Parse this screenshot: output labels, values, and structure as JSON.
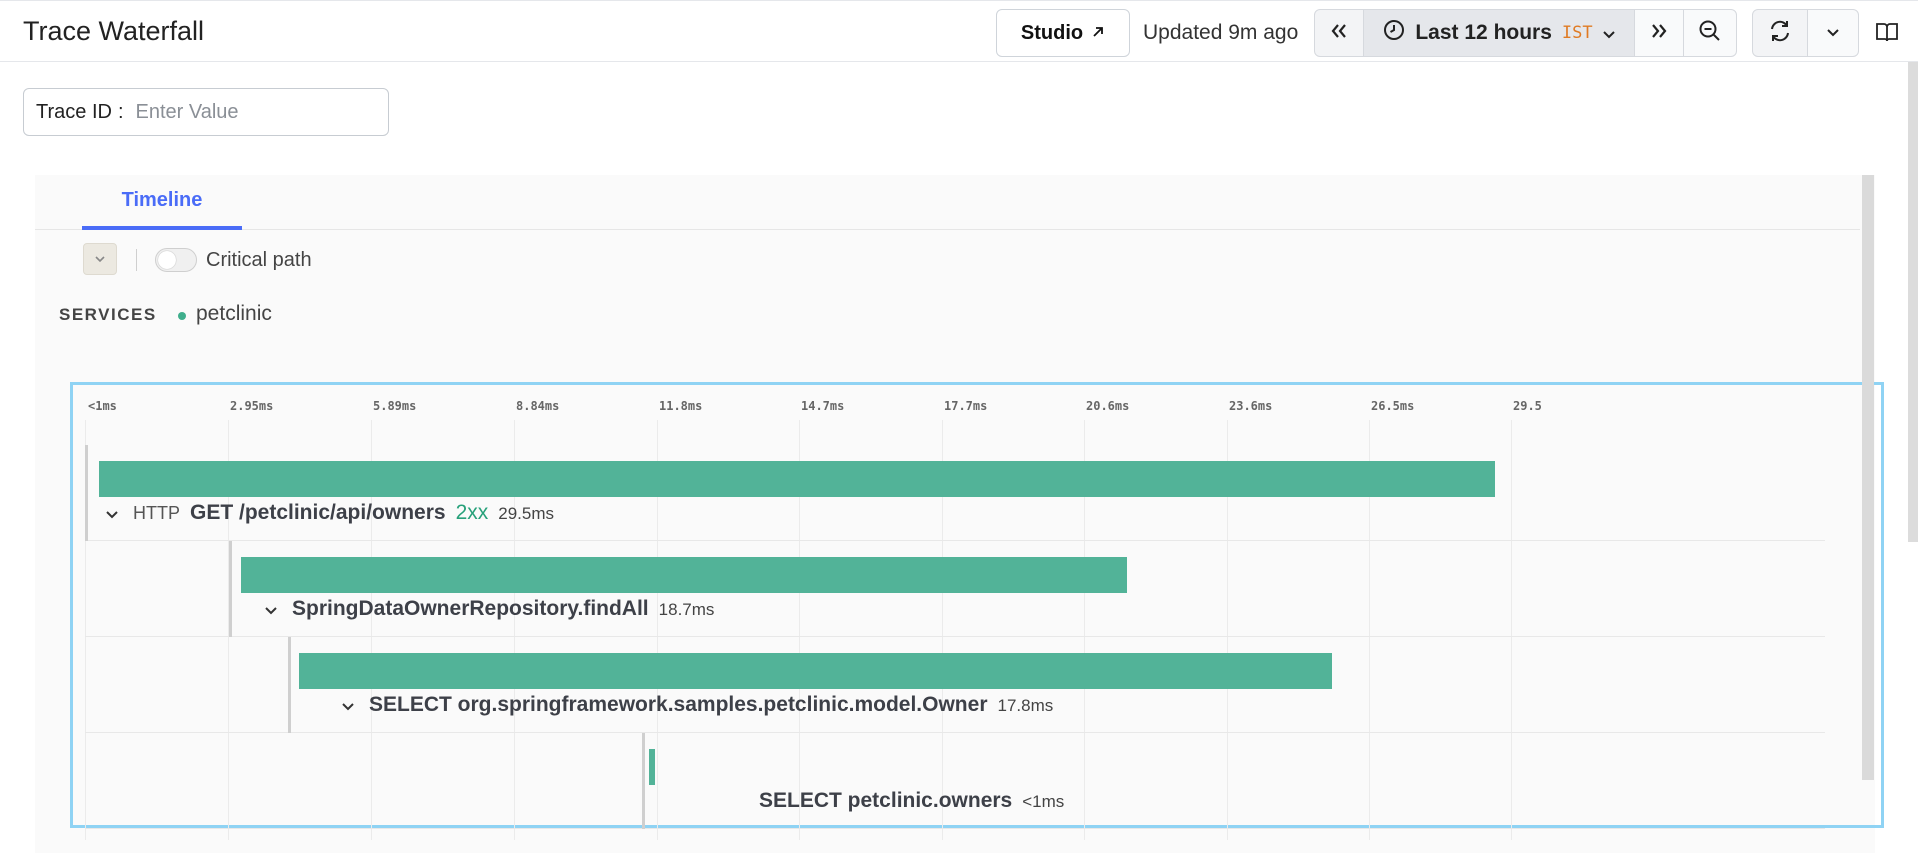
{
  "header": {
    "title": "Trace Waterfall",
    "studio_label": "Studio",
    "updated_text": "Updated 9m ago",
    "time_range": "Last 12 hours",
    "timezone": "IST"
  },
  "trace": {
    "label": "Trace ID",
    "separator": ":",
    "placeholder": "Enter Value"
  },
  "tabs": [
    {
      "label": "Timeline"
    }
  ],
  "toolbar": {
    "critical_path_label": "Critical path",
    "critical_path_on": false
  },
  "services": {
    "label": "SERVICES",
    "items": [
      {
        "name": "petclinic",
        "color": "#3fae8c"
      }
    ]
  },
  "timeline": {
    "ticks": [
      "<1ms",
      "2.95ms",
      "5.89ms",
      "8.84ms",
      "11.8ms",
      "14.7ms",
      "17.7ms",
      "20.6ms",
      "23.6ms",
      "26.5ms",
      "29.5"
    ],
    "bar_color": "#52b398",
    "spans": [
      {
        "kind": "HTTP",
        "name": "GET /petclinic/api/owners",
        "status": "2xx",
        "duration": "29.5ms"
      },
      {
        "kind": "",
        "name": "SpringDataOwnerRepository.findAll",
        "status": "",
        "duration": "18.7ms"
      },
      {
        "kind": "",
        "name": "SELECT org.springframework.samples.petclinic.model.Owner",
        "status": "",
        "duration": "17.8ms"
      },
      {
        "kind": "",
        "name": "SELECT petclinic.owners",
        "status": "",
        "duration": "<1ms"
      }
    ]
  },
  "colors": {
    "accent": "#4a6cf7",
    "bar": "#52b398",
    "status_ok": "#27a17a",
    "highlight_border": "#8fd3f4"
  }
}
